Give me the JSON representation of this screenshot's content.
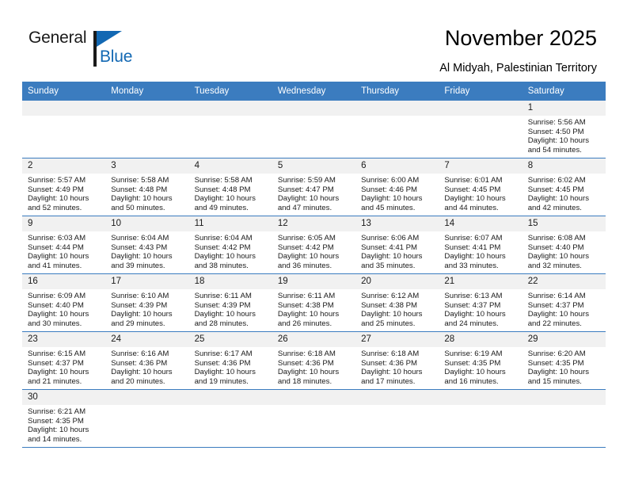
{
  "brand": {
    "name_top": "General",
    "name_bottom": "Blue",
    "accent_color": "#1268b3"
  },
  "header": {
    "title": "November 2025",
    "subtitle": "Al Midyah, Palestinian Territory"
  },
  "theme": {
    "header_row_bg": "#3b7cbf",
    "daynum_bg": "#f1f1f1",
    "grid_line": "#3b7cbf"
  },
  "weekdays": [
    "Sunday",
    "Monday",
    "Tuesday",
    "Wednesday",
    "Thursday",
    "Friday",
    "Saturday"
  ],
  "weeks": [
    [
      {
        "day": "",
        "sunrise": "",
        "sunset": "",
        "daylight_line1": "",
        "daylight_line2": ""
      },
      {
        "day": "",
        "sunrise": "",
        "sunset": "",
        "daylight_line1": "",
        "daylight_line2": ""
      },
      {
        "day": "",
        "sunrise": "",
        "sunset": "",
        "daylight_line1": "",
        "daylight_line2": ""
      },
      {
        "day": "",
        "sunrise": "",
        "sunset": "",
        "daylight_line1": "",
        "daylight_line2": ""
      },
      {
        "day": "",
        "sunrise": "",
        "sunset": "",
        "daylight_line1": "",
        "daylight_line2": ""
      },
      {
        "day": "",
        "sunrise": "",
        "sunset": "",
        "daylight_line1": "",
        "daylight_line2": ""
      },
      {
        "day": "1",
        "sunrise": "Sunrise: 5:56 AM",
        "sunset": "Sunset: 4:50 PM",
        "daylight_line1": "Daylight: 10 hours",
        "daylight_line2": "and 54 minutes."
      }
    ],
    [
      {
        "day": "2",
        "sunrise": "Sunrise: 5:57 AM",
        "sunset": "Sunset: 4:49 PM",
        "daylight_line1": "Daylight: 10 hours",
        "daylight_line2": "and 52 minutes."
      },
      {
        "day": "3",
        "sunrise": "Sunrise: 5:58 AM",
        "sunset": "Sunset: 4:48 PM",
        "daylight_line1": "Daylight: 10 hours",
        "daylight_line2": "and 50 minutes."
      },
      {
        "day": "4",
        "sunrise": "Sunrise: 5:58 AM",
        "sunset": "Sunset: 4:48 PM",
        "daylight_line1": "Daylight: 10 hours",
        "daylight_line2": "and 49 minutes."
      },
      {
        "day": "5",
        "sunrise": "Sunrise: 5:59 AM",
        "sunset": "Sunset: 4:47 PM",
        "daylight_line1": "Daylight: 10 hours",
        "daylight_line2": "and 47 minutes."
      },
      {
        "day": "6",
        "sunrise": "Sunrise: 6:00 AM",
        "sunset": "Sunset: 4:46 PM",
        "daylight_line1": "Daylight: 10 hours",
        "daylight_line2": "and 45 minutes."
      },
      {
        "day": "7",
        "sunrise": "Sunrise: 6:01 AM",
        "sunset": "Sunset: 4:45 PM",
        "daylight_line1": "Daylight: 10 hours",
        "daylight_line2": "and 44 minutes."
      },
      {
        "day": "8",
        "sunrise": "Sunrise: 6:02 AM",
        "sunset": "Sunset: 4:45 PM",
        "daylight_line1": "Daylight: 10 hours",
        "daylight_line2": "and 42 minutes."
      }
    ],
    [
      {
        "day": "9",
        "sunrise": "Sunrise: 6:03 AM",
        "sunset": "Sunset: 4:44 PM",
        "daylight_line1": "Daylight: 10 hours",
        "daylight_line2": "and 41 minutes."
      },
      {
        "day": "10",
        "sunrise": "Sunrise: 6:04 AM",
        "sunset": "Sunset: 4:43 PM",
        "daylight_line1": "Daylight: 10 hours",
        "daylight_line2": "and 39 minutes."
      },
      {
        "day": "11",
        "sunrise": "Sunrise: 6:04 AM",
        "sunset": "Sunset: 4:42 PM",
        "daylight_line1": "Daylight: 10 hours",
        "daylight_line2": "and 38 minutes."
      },
      {
        "day": "12",
        "sunrise": "Sunrise: 6:05 AM",
        "sunset": "Sunset: 4:42 PM",
        "daylight_line1": "Daylight: 10 hours",
        "daylight_line2": "and 36 minutes."
      },
      {
        "day": "13",
        "sunrise": "Sunrise: 6:06 AM",
        "sunset": "Sunset: 4:41 PM",
        "daylight_line1": "Daylight: 10 hours",
        "daylight_line2": "and 35 minutes."
      },
      {
        "day": "14",
        "sunrise": "Sunrise: 6:07 AM",
        "sunset": "Sunset: 4:41 PM",
        "daylight_line1": "Daylight: 10 hours",
        "daylight_line2": "and 33 minutes."
      },
      {
        "day": "15",
        "sunrise": "Sunrise: 6:08 AM",
        "sunset": "Sunset: 4:40 PM",
        "daylight_line1": "Daylight: 10 hours",
        "daylight_line2": "and 32 minutes."
      }
    ],
    [
      {
        "day": "16",
        "sunrise": "Sunrise: 6:09 AM",
        "sunset": "Sunset: 4:40 PM",
        "daylight_line1": "Daylight: 10 hours",
        "daylight_line2": "and 30 minutes."
      },
      {
        "day": "17",
        "sunrise": "Sunrise: 6:10 AM",
        "sunset": "Sunset: 4:39 PM",
        "daylight_line1": "Daylight: 10 hours",
        "daylight_line2": "and 29 minutes."
      },
      {
        "day": "18",
        "sunrise": "Sunrise: 6:11 AM",
        "sunset": "Sunset: 4:39 PM",
        "daylight_line1": "Daylight: 10 hours",
        "daylight_line2": "and 28 minutes."
      },
      {
        "day": "19",
        "sunrise": "Sunrise: 6:11 AM",
        "sunset": "Sunset: 4:38 PM",
        "daylight_line1": "Daylight: 10 hours",
        "daylight_line2": "and 26 minutes."
      },
      {
        "day": "20",
        "sunrise": "Sunrise: 6:12 AM",
        "sunset": "Sunset: 4:38 PM",
        "daylight_line1": "Daylight: 10 hours",
        "daylight_line2": "and 25 minutes."
      },
      {
        "day": "21",
        "sunrise": "Sunrise: 6:13 AM",
        "sunset": "Sunset: 4:37 PM",
        "daylight_line1": "Daylight: 10 hours",
        "daylight_line2": "and 24 minutes."
      },
      {
        "day": "22",
        "sunrise": "Sunrise: 6:14 AM",
        "sunset": "Sunset: 4:37 PM",
        "daylight_line1": "Daylight: 10 hours",
        "daylight_line2": "and 22 minutes."
      }
    ],
    [
      {
        "day": "23",
        "sunrise": "Sunrise: 6:15 AM",
        "sunset": "Sunset: 4:37 PM",
        "daylight_line1": "Daylight: 10 hours",
        "daylight_line2": "and 21 minutes."
      },
      {
        "day": "24",
        "sunrise": "Sunrise: 6:16 AM",
        "sunset": "Sunset: 4:36 PM",
        "daylight_line1": "Daylight: 10 hours",
        "daylight_line2": "and 20 minutes."
      },
      {
        "day": "25",
        "sunrise": "Sunrise: 6:17 AM",
        "sunset": "Sunset: 4:36 PM",
        "daylight_line1": "Daylight: 10 hours",
        "daylight_line2": "and 19 minutes."
      },
      {
        "day": "26",
        "sunrise": "Sunrise: 6:18 AM",
        "sunset": "Sunset: 4:36 PM",
        "daylight_line1": "Daylight: 10 hours",
        "daylight_line2": "and 18 minutes."
      },
      {
        "day": "27",
        "sunrise": "Sunrise: 6:18 AM",
        "sunset": "Sunset: 4:36 PM",
        "daylight_line1": "Daylight: 10 hours",
        "daylight_line2": "and 17 minutes."
      },
      {
        "day": "28",
        "sunrise": "Sunrise: 6:19 AM",
        "sunset": "Sunset: 4:35 PM",
        "daylight_line1": "Daylight: 10 hours",
        "daylight_line2": "and 16 minutes."
      },
      {
        "day": "29",
        "sunrise": "Sunrise: 6:20 AM",
        "sunset": "Sunset: 4:35 PM",
        "daylight_line1": "Daylight: 10 hours",
        "daylight_line2": "and 15 minutes."
      }
    ],
    [
      {
        "day": "30",
        "sunrise": "Sunrise: 6:21 AM",
        "sunset": "Sunset: 4:35 PM",
        "daylight_line1": "Daylight: 10 hours",
        "daylight_line2": "and 14 minutes."
      },
      {
        "day": "",
        "sunrise": "",
        "sunset": "",
        "daylight_line1": "",
        "daylight_line2": ""
      },
      {
        "day": "",
        "sunrise": "",
        "sunset": "",
        "daylight_line1": "",
        "daylight_line2": ""
      },
      {
        "day": "",
        "sunrise": "",
        "sunset": "",
        "daylight_line1": "",
        "daylight_line2": ""
      },
      {
        "day": "",
        "sunrise": "",
        "sunset": "",
        "daylight_line1": "",
        "daylight_line2": ""
      },
      {
        "day": "",
        "sunrise": "",
        "sunset": "",
        "daylight_line1": "",
        "daylight_line2": ""
      },
      {
        "day": "",
        "sunrise": "",
        "sunset": "",
        "daylight_line1": "",
        "daylight_line2": ""
      }
    ]
  ]
}
